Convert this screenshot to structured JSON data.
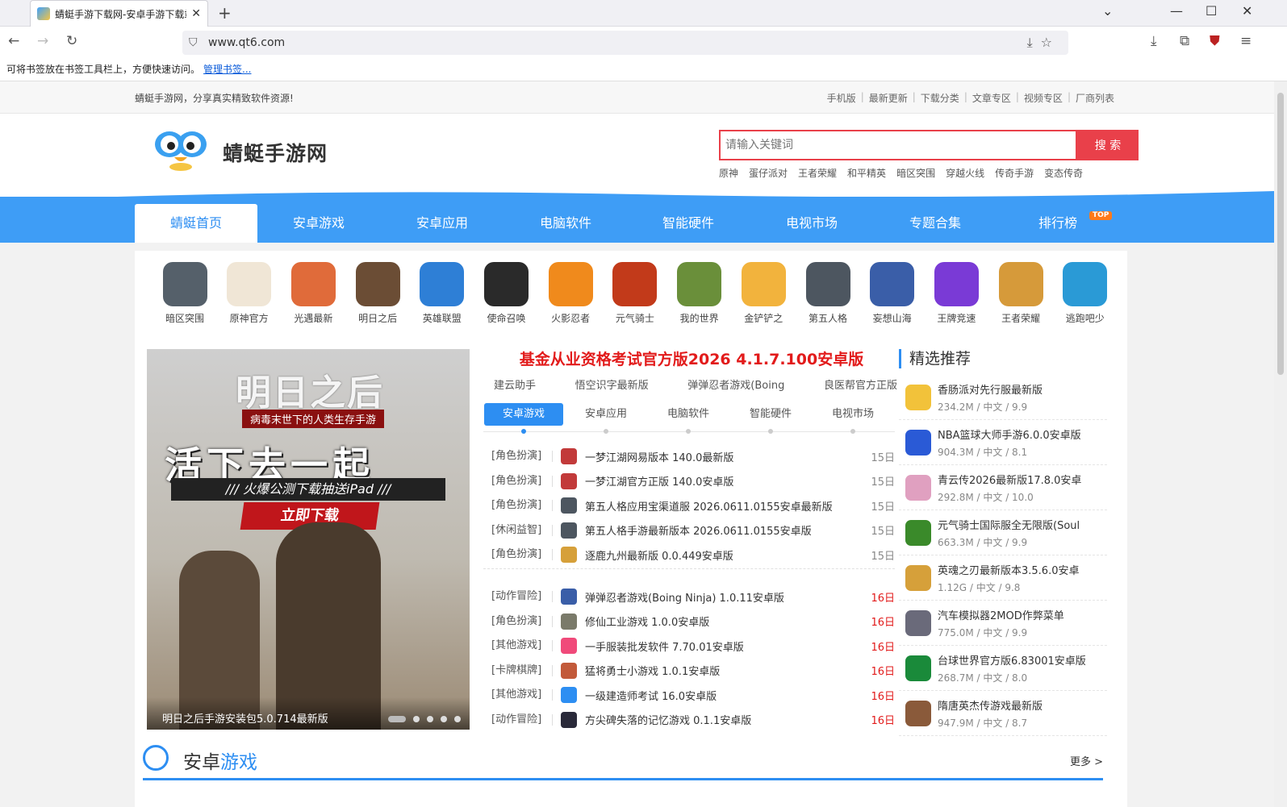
{
  "browser": {
    "tab_title": "蜻蜓手游下载网-安卓手游下载站",
    "url": "www.qt6.com",
    "bookmark_hint": "可将书签放在书签工具栏上，方便快速访问。",
    "bookmark_manage": "管理书签..."
  },
  "topbar": {
    "slogan": "蜻蜓手游网，分享真实精致软件资源!",
    "links": [
      "手机版",
      "最新更新",
      "下载分类",
      "文章专区",
      "视频专区",
      "厂商列表"
    ]
  },
  "header": {
    "logo_text": "蜻蜓手游网",
    "search_placeholder": "请输入关键词",
    "search_button": "搜 索",
    "hot_words": [
      "原神",
      "蛋仔派对",
      "王者荣耀",
      "和平精英",
      "暗区突围",
      "穿越火线",
      "传奇手游",
      "变态传奇"
    ]
  },
  "nav": {
    "items": [
      "蜻蜓首页",
      "安卓游戏",
      "安卓应用",
      "电脑软件",
      "智能硬件",
      "电视市场",
      "专题合集",
      "排行榜"
    ],
    "badge": "TOP"
  },
  "icons": [
    {
      "name": "暗区突围",
      "color": "#55606a"
    },
    {
      "name": "原神官方",
      "color": "#f0e6d6"
    },
    {
      "name": "光遇最新",
      "color": "#e06b3a"
    },
    {
      "name": "明日之后",
      "color": "#6b4d35"
    },
    {
      "name": "英雄联盟",
      "color": "#2e7fd6"
    },
    {
      "name": "使命召唤",
      "color": "#2a2a2a"
    },
    {
      "name": "火影忍者",
      "color": "#f08a1c"
    },
    {
      "name": "元气骑士",
      "color": "#c23a1a"
    },
    {
      "name": "我的世界",
      "color": "#6a8f3a"
    },
    {
      "name": "金铲铲之",
      "color": "#f2b33d"
    },
    {
      "name": "第五人格",
      "color": "#4d5660"
    },
    {
      "name": "妄想山海",
      "color": "#3a5ea8"
    },
    {
      "name": "王牌竞速",
      "color": "#7a3ad6"
    },
    {
      "name": "王者荣耀",
      "color": "#d69a3a"
    },
    {
      "name": "逃跑吧少",
      "color": "#2a9ad6"
    }
  ],
  "banner": {
    "title": "明日之后",
    "subtitle": "病毒末世下的人类生存手游",
    "slogan": "活下去一起",
    "promo": "/// 火爆公测下载抽送iPad ///",
    "cta": "立即下载",
    "caption": "明日之后手游安装包5.0.714最新版"
  },
  "headline": "基金从业资格考试官方版2026 4.1.7.100安卓版",
  "sublinks": [
    "建云助手",
    "悟空识字最新版",
    "弹弹忍者游戏(Boing",
    "良医帮官方正版"
  ],
  "tabs": [
    "安卓游戏",
    "安卓应用",
    "电脑软件",
    "智能硬件",
    "电视市场"
  ],
  "list1": [
    {
      "cat": "[角色扮演]",
      "title": "一梦江湖网易版本 140.0最新版",
      "date": "15日",
      "color": "#c23a3a"
    },
    {
      "cat": "[角色扮演]",
      "title": "一梦江湖官方正版 140.0安卓版",
      "date": "15日",
      "color": "#c23a3a"
    },
    {
      "cat": "[角色扮演]",
      "title": "第五人格应用宝渠道服 2026.0611.0155安卓最新版",
      "date": "15日",
      "color": "#4d5660"
    },
    {
      "cat": "[休闲益智]",
      "title": "第五人格手游最新版本 2026.0611.0155安卓版",
      "date": "15日",
      "color": "#4d5660"
    },
    {
      "cat": "[角色扮演]",
      "title": "逐鹿九州最新版 0.0.449安卓版",
      "date": "15日",
      "color": "#d6a03a"
    }
  ],
  "list2": [
    {
      "cat": "[动作冒险]",
      "title": "弹弹忍者游戏(Boing Ninja) 1.0.11安卓版",
      "date": "16日",
      "color": "#3a5ea8"
    },
    {
      "cat": "[角色扮演]",
      "title": "修仙工业游戏 1.0.0安卓版",
      "date": "16日",
      "color": "#7a7a6a"
    },
    {
      "cat": "[其他游戏]",
      "title": "一手服装批发软件 7.70.01安卓版",
      "date": "16日",
      "color": "#f04a7a"
    },
    {
      "cat": "[卡牌棋牌]",
      "title": "猛将勇士小游戏 1.0.1安卓版",
      "date": "16日",
      "color": "#c25a3a"
    },
    {
      "cat": "[其他游戏]",
      "title": "一级建造师考试 16.0安卓版",
      "date": "16日",
      "color": "#2d8ef2"
    },
    {
      "cat": "[动作冒险]",
      "title": "方尖碑失落的记忆游戏 0.1.1安卓版",
      "date": "16日",
      "color": "#2a2a3a"
    }
  ],
  "side": {
    "title": "精选推荐",
    "items": [
      {
        "name": "香肠派对先行服最新版",
        "meta": "234.2M / 中文 / 9.9",
        "color": "#f2c23a"
      },
      {
        "name": "NBA篮球大师手游6.0.0安卓版",
        "meta": "904.3M / 中文 / 8.1",
        "color": "#2a5ad6"
      },
      {
        "name": "青云传2026最新版17.8.0安卓",
        "meta": "292.8M / 中文 / 10.0",
        "color": "#e0a0c0"
      },
      {
        "name": "元气骑士国际服全无限版(Soul",
        "meta": "663.3M / 中文 / 9.9",
        "color": "#3a8a2a"
      },
      {
        "name": "英魂之刃最新版本3.5.6.0安卓",
        "meta": "1.12G / 中文 / 9.8",
        "color": "#d6a03a"
      },
      {
        "name": "汽车模拟器2MOD作弊菜单",
        "meta": "775.0M / 中文 / 9.9",
        "color": "#6a6a7a"
      },
      {
        "name": "台球世界官方版6.83001安卓版",
        "meta": "268.7M / 中文 / 8.0",
        "color": "#1a8a3a"
      },
      {
        "name": "隋唐英杰传游戏最新版",
        "meta": "947.9M / 中文 / 8.7",
        "color": "#8a5a3a"
      }
    ]
  },
  "section": {
    "title_a": "安卓",
    "title_b": "游戏",
    "more": "更多 >"
  }
}
